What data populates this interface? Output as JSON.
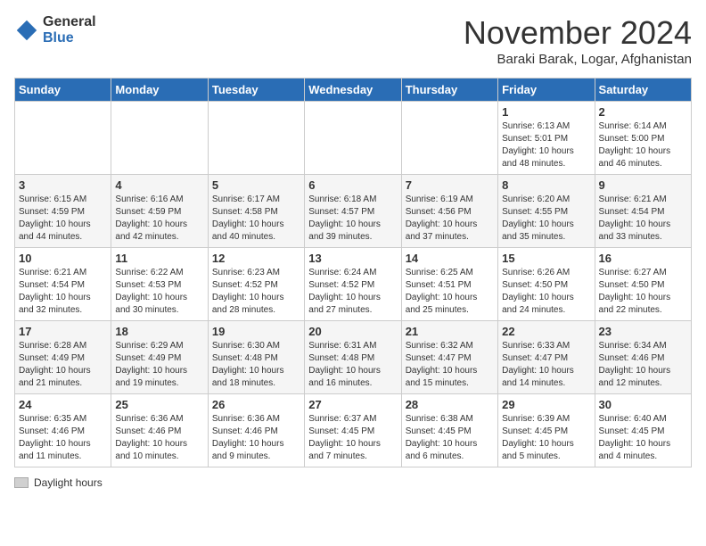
{
  "logo": {
    "general": "General",
    "blue": "Blue"
  },
  "title": "November 2024",
  "location": "Baraki Barak, Logar, Afghanistan",
  "days_of_week": [
    "Sunday",
    "Monday",
    "Tuesday",
    "Wednesday",
    "Thursday",
    "Friday",
    "Saturday"
  ],
  "legend": {
    "box_label": "Daylight hours"
  },
  "weeks": [
    [
      {
        "day": "",
        "info": ""
      },
      {
        "day": "",
        "info": ""
      },
      {
        "day": "",
        "info": ""
      },
      {
        "day": "",
        "info": ""
      },
      {
        "day": "",
        "info": ""
      },
      {
        "day": "1",
        "info": "Sunrise: 6:13 AM\nSunset: 5:01 PM\nDaylight: 10 hours\nand 48 minutes."
      },
      {
        "day": "2",
        "info": "Sunrise: 6:14 AM\nSunset: 5:00 PM\nDaylight: 10 hours\nand 46 minutes."
      }
    ],
    [
      {
        "day": "3",
        "info": "Sunrise: 6:15 AM\nSunset: 4:59 PM\nDaylight: 10 hours\nand 44 minutes."
      },
      {
        "day": "4",
        "info": "Sunrise: 6:16 AM\nSunset: 4:59 PM\nDaylight: 10 hours\nand 42 minutes."
      },
      {
        "day": "5",
        "info": "Sunrise: 6:17 AM\nSunset: 4:58 PM\nDaylight: 10 hours\nand 40 minutes."
      },
      {
        "day": "6",
        "info": "Sunrise: 6:18 AM\nSunset: 4:57 PM\nDaylight: 10 hours\nand 39 minutes."
      },
      {
        "day": "7",
        "info": "Sunrise: 6:19 AM\nSunset: 4:56 PM\nDaylight: 10 hours\nand 37 minutes."
      },
      {
        "day": "8",
        "info": "Sunrise: 6:20 AM\nSunset: 4:55 PM\nDaylight: 10 hours\nand 35 minutes."
      },
      {
        "day": "9",
        "info": "Sunrise: 6:21 AM\nSunset: 4:54 PM\nDaylight: 10 hours\nand 33 minutes."
      }
    ],
    [
      {
        "day": "10",
        "info": "Sunrise: 6:21 AM\nSunset: 4:54 PM\nDaylight: 10 hours\nand 32 minutes."
      },
      {
        "day": "11",
        "info": "Sunrise: 6:22 AM\nSunset: 4:53 PM\nDaylight: 10 hours\nand 30 minutes."
      },
      {
        "day": "12",
        "info": "Sunrise: 6:23 AM\nSunset: 4:52 PM\nDaylight: 10 hours\nand 28 minutes."
      },
      {
        "day": "13",
        "info": "Sunrise: 6:24 AM\nSunset: 4:52 PM\nDaylight: 10 hours\nand 27 minutes."
      },
      {
        "day": "14",
        "info": "Sunrise: 6:25 AM\nSunset: 4:51 PM\nDaylight: 10 hours\nand 25 minutes."
      },
      {
        "day": "15",
        "info": "Sunrise: 6:26 AM\nSunset: 4:50 PM\nDaylight: 10 hours\nand 24 minutes."
      },
      {
        "day": "16",
        "info": "Sunrise: 6:27 AM\nSunset: 4:50 PM\nDaylight: 10 hours\nand 22 minutes."
      }
    ],
    [
      {
        "day": "17",
        "info": "Sunrise: 6:28 AM\nSunset: 4:49 PM\nDaylight: 10 hours\nand 21 minutes."
      },
      {
        "day": "18",
        "info": "Sunrise: 6:29 AM\nSunset: 4:49 PM\nDaylight: 10 hours\nand 19 minutes."
      },
      {
        "day": "19",
        "info": "Sunrise: 6:30 AM\nSunset: 4:48 PM\nDaylight: 10 hours\nand 18 minutes."
      },
      {
        "day": "20",
        "info": "Sunrise: 6:31 AM\nSunset: 4:48 PM\nDaylight: 10 hours\nand 16 minutes."
      },
      {
        "day": "21",
        "info": "Sunrise: 6:32 AM\nSunset: 4:47 PM\nDaylight: 10 hours\nand 15 minutes."
      },
      {
        "day": "22",
        "info": "Sunrise: 6:33 AM\nSunset: 4:47 PM\nDaylight: 10 hours\nand 14 minutes."
      },
      {
        "day": "23",
        "info": "Sunrise: 6:34 AM\nSunset: 4:46 PM\nDaylight: 10 hours\nand 12 minutes."
      }
    ],
    [
      {
        "day": "24",
        "info": "Sunrise: 6:35 AM\nSunset: 4:46 PM\nDaylight: 10 hours\nand 11 minutes."
      },
      {
        "day": "25",
        "info": "Sunrise: 6:36 AM\nSunset: 4:46 PM\nDaylight: 10 hours\nand 10 minutes."
      },
      {
        "day": "26",
        "info": "Sunrise: 6:36 AM\nSunset: 4:46 PM\nDaylight: 10 hours\nand 9 minutes."
      },
      {
        "day": "27",
        "info": "Sunrise: 6:37 AM\nSunset: 4:45 PM\nDaylight: 10 hours\nand 7 minutes."
      },
      {
        "day": "28",
        "info": "Sunrise: 6:38 AM\nSunset: 4:45 PM\nDaylight: 10 hours\nand 6 minutes."
      },
      {
        "day": "29",
        "info": "Sunrise: 6:39 AM\nSunset: 4:45 PM\nDaylight: 10 hours\nand 5 minutes."
      },
      {
        "day": "30",
        "info": "Sunrise: 6:40 AM\nSunset: 4:45 PM\nDaylight: 10 hours\nand 4 minutes."
      }
    ]
  ]
}
